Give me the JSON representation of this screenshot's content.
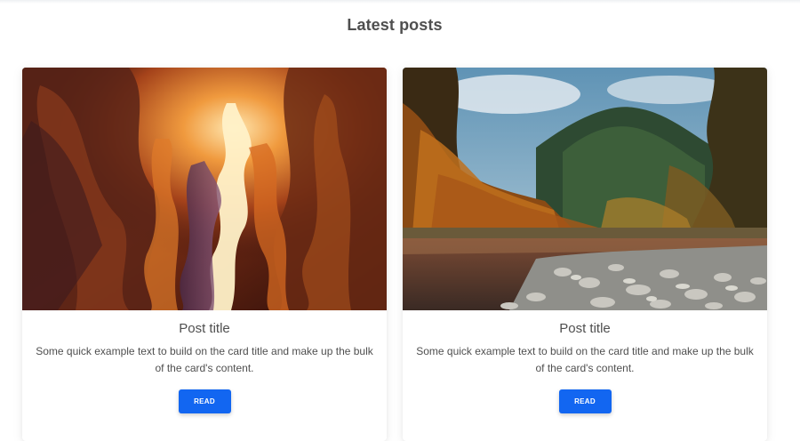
{
  "section": {
    "title": "Latest posts"
  },
  "cards": [
    {
      "image_alt": "canyon-photo",
      "title": "Post title",
      "text": "Some quick example text to build on the card title and make up the bulk of the card's content.",
      "button_label": "READ"
    },
    {
      "image_alt": "river-forest-photo",
      "title": "Post title",
      "text": "Some quick example text to build on the card title and make up the bulk of the card's content.",
      "button_label": "READ"
    }
  ],
  "colors": {
    "accent": "#1266f1",
    "text": "#4f4f4f",
    "background": "#ffffff"
  }
}
